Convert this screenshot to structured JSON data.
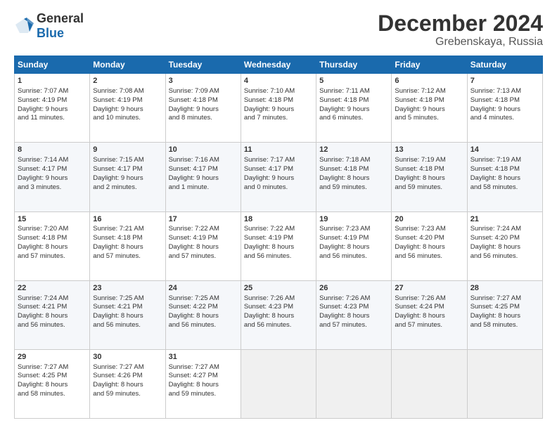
{
  "header": {
    "logo_general": "General",
    "logo_blue": "Blue",
    "title": "December 2024",
    "subtitle": "Grebenskaya, Russia"
  },
  "columns": [
    "Sunday",
    "Monday",
    "Tuesday",
    "Wednesday",
    "Thursday",
    "Friday",
    "Saturday"
  ],
  "weeks": [
    [
      {
        "day": "1",
        "lines": [
          "Sunrise: 7:07 AM",
          "Sunset: 4:19 PM",
          "Daylight: 9 hours",
          "and 11 minutes."
        ]
      },
      {
        "day": "2",
        "lines": [
          "Sunrise: 7:08 AM",
          "Sunset: 4:19 PM",
          "Daylight: 9 hours",
          "and 10 minutes."
        ]
      },
      {
        "day": "3",
        "lines": [
          "Sunrise: 7:09 AM",
          "Sunset: 4:18 PM",
          "Daylight: 9 hours",
          "and 8 minutes."
        ]
      },
      {
        "day": "4",
        "lines": [
          "Sunrise: 7:10 AM",
          "Sunset: 4:18 PM",
          "Daylight: 9 hours",
          "and 7 minutes."
        ]
      },
      {
        "day": "5",
        "lines": [
          "Sunrise: 7:11 AM",
          "Sunset: 4:18 PM",
          "Daylight: 9 hours",
          "and 6 minutes."
        ]
      },
      {
        "day": "6",
        "lines": [
          "Sunrise: 7:12 AM",
          "Sunset: 4:18 PM",
          "Daylight: 9 hours",
          "and 5 minutes."
        ]
      },
      {
        "day": "7",
        "lines": [
          "Sunrise: 7:13 AM",
          "Sunset: 4:18 PM",
          "Daylight: 9 hours",
          "and 4 minutes."
        ]
      }
    ],
    [
      {
        "day": "8",
        "lines": [
          "Sunrise: 7:14 AM",
          "Sunset: 4:17 PM",
          "Daylight: 9 hours",
          "and 3 minutes."
        ]
      },
      {
        "day": "9",
        "lines": [
          "Sunrise: 7:15 AM",
          "Sunset: 4:17 PM",
          "Daylight: 9 hours",
          "and 2 minutes."
        ]
      },
      {
        "day": "10",
        "lines": [
          "Sunrise: 7:16 AM",
          "Sunset: 4:17 PM",
          "Daylight: 9 hours",
          "and 1 minute."
        ]
      },
      {
        "day": "11",
        "lines": [
          "Sunrise: 7:17 AM",
          "Sunset: 4:17 PM",
          "Daylight: 9 hours",
          "and 0 minutes."
        ]
      },
      {
        "day": "12",
        "lines": [
          "Sunrise: 7:18 AM",
          "Sunset: 4:18 PM",
          "Daylight: 8 hours",
          "and 59 minutes."
        ]
      },
      {
        "day": "13",
        "lines": [
          "Sunrise: 7:19 AM",
          "Sunset: 4:18 PM",
          "Daylight: 8 hours",
          "and 59 minutes."
        ]
      },
      {
        "day": "14",
        "lines": [
          "Sunrise: 7:19 AM",
          "Sunset: 4:18 PM",
          "Daylight: 8 hours",
          "and 58 minutes."
        ]
      }
    ],
    [
      {
        "day": "15",
        "lines": [
          "Sunrise: 7:20 AM",
          "Sunset: 4:18 PM",
          "Daylight: 8 hours",
          "and 57 minutes."
        ]
      },
      {
        "day": "16",
        "lines": [
          "Sunrise: 7:21 AM",
          "Sunset: 4:18 PM",
          "Daylight: 8 hours",
          "and 57 minutes."
        ]
      },
      {
        "day": "17",
        "lines": [
          "Sunrise: 7:22 AM",
          "Sunset: 4:19 PM",
          "Daylight: 8 hours",
          "and 57 minutes."
        ]
      },
      {
        "day": "18",
        "lines": [
          "Sunrise: 7:22 AM",
          "Sunset: 4:19 PM",
          "Daylight: 8 hours",
          "and 56 minutes."
        ]
      },
      {
        "day": "19",
        "lines": [
          "Sunrise: 7:23 AM",
          "Sunset: 4:19 PM",
          "Daylight: 8 hours",
          "and 56 minutes."
        ]
      },
      {
        "day": "20",
        "lines": [
          "Sunrise: 7:23 AM",
          "Sunset: 4:20 PM",
          "Daylight: 8 hours",
          "and 56 minutes."
        ]
      },
      {
        "day": "21",
        "lines": [
          "Sunrise: 7:24 AM",
          "Sunset: 4:20 PM",
          "Daylight: 8 hours",
          "and 56 minutes."
        ]
      }
    ],
    [
      {
        "day": "22",
        "lines": [
          "Sunrise: 7:24 AM",
          "Sunset: 4:21 PM",
          "Daylight: 8 hours",
          "and 56 minutes."
        ]
      },
      {
        "day": "23",
        "lines": [
          "Sunrise: 7:25 AM",
          "Sunset: 4:21 PM",
          "Daylight: 8 hours",
          "and 56 minutes."
        ]
      },
      {
        "day": "24",
        "lines": [
          "Sunrise: 7:25 AM",
          "Sunset: 4:22 PM",
          "Daylight: 8 hours",
          "and 56 minutes."
        ]
      },
      {
        "day": "25",
        "lines": [
          "Sunrise: 7:26 AM",
          "Sunset: 4:23 PM",
          "Daylight: 8 hours",
          "and 56 minutes."
        ]
      },
      {
        "day": "26",
        "lines": [
          "Sunrise: 7:26 AM",
          "Sunset: 4:23 PM",
          "Daylight: 8 hours",
          "and 57 minutes."
        ]
      },
      {
        "day": "27",
        "lines": [
          "Sunrise: 7:26 AM",
          "Sunset: 4:24 PM",
          "Daylight: 8 hours",
          "and 57 minutes."
        ]
      },
      {
        "day": "28",
        "lines": [
          "Sunrise: 7:27 AM",
          "Sunset: 4:25 PM",
          "Daylight: 8 hours",
          "and 58 minutes."
        ]
      }
    ],
    [
      {
        "day": "29",
        "lines": [
          "Sunrise: 7:27 AM",
          "Sunset: 4:25 PM",
          "Daylight: 8 hours",
          "and 58 minutes."
        ]
      },
      {
        "day": "30",
        "lines": [
          "Sunrise: 7:27 AM",
          "Sunset: 4:26 PM",
          "Daylight: 8 hours",
          "and 59 minutes."
        ]
      },
      {
        "day": "31",
        "lines": [
          "Sunrise: 7:27 AM",
          "Sunset: 4:27 PM",
          "Daylight: 8 hours",
          "and 59 minutes."
        ]
      },
      null,
      null,
      null,
      null
    ]
  ]
}
